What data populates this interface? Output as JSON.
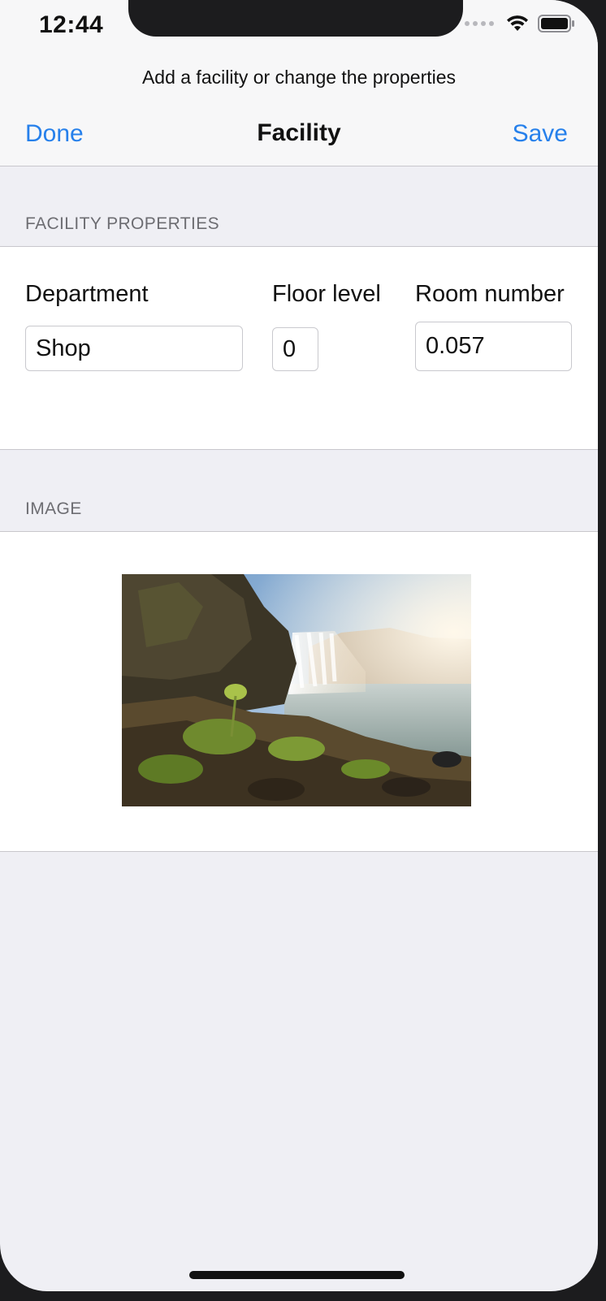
{
  "status_bar": {
    "time": "12:44",
    "icons": [
      "cellular-signal-icon",
      "wifi-icon",
      "battery-icon"
    ]
  },
  "header": {
    "prompt": "Add  a facility or change the properties",
    "title": "Facility",
    "left_button": "Done",
    "right_button": "Save"
  },
  "sections": {
    "properties": {
      "header": "FACILITY PROPERTIES",
      "fields": {
        "department": {
          "label": "Department",
          "value": "Shop"
        },
        "floor_level": {
          "label": "Floor level",
          "value": "0"
        },
        "room_number": {
          "label": "Room number",
          "value": "0.057"
        }
      }
    },
    "image": {
      "header": "IMAGE",
      "photo": "waterfall-landscape-image"
    }
  },
  "colors": {
    "accent": "#2680eb",
    "background": "#efeff4",
    "section_text": "#6d6d72"
  }
}
